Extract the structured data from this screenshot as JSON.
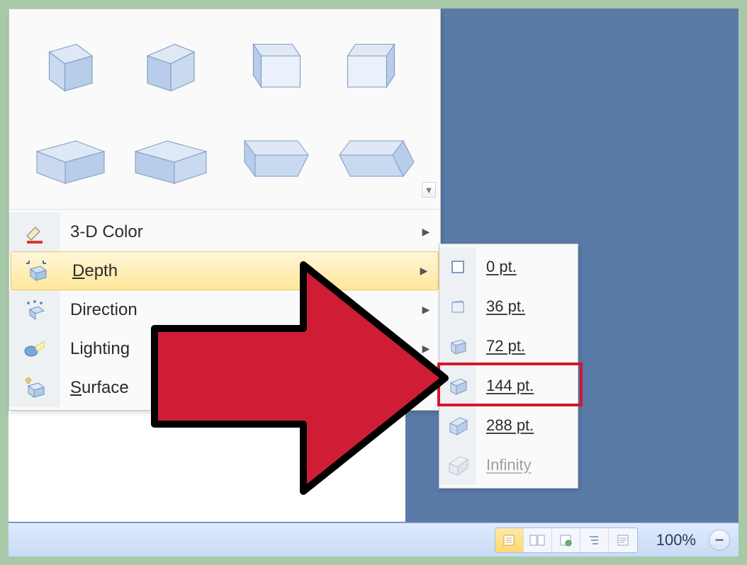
{
  "menu": {
    "color": "3-D Color",
    "depth": "Depth",
    "direction": "Direction",
    "lighting": "Lighting",
    "surface": "Surface"
  },
  "depth_options": [
    {
      "label": "0 pt.",
      "dim": false
    },
    {
      "label": "36 pt.",
      "dim": false
    },
    {
      "label": "72 pt.",
      "dim": false
    },
    {
      "label": "144 pt.",
      "dim": false
    },
    {
      "label": "288 pt.",
      "dim": false
    },
    {
      "label": "Infinity",
      "dim": true
    }
  ],
  "status": {
    "zoom": "100%"
  }
}
